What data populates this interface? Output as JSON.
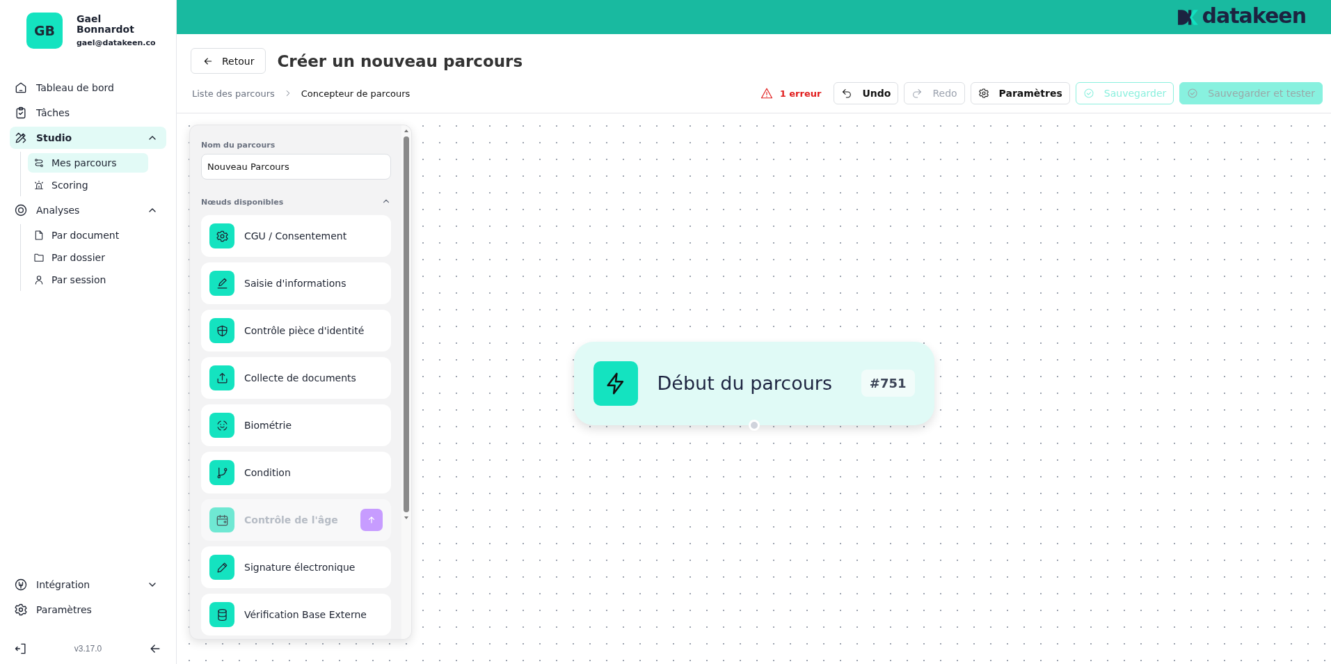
{
  "user": {
    "initials": "GB",
    "name": "Gael Bonnardot",
    "email": "gael@datakeen.co"
  },
  "nav": [
    {
      "label": "Tableau de bord",
      "selected": false
    },
    {
      "label": "Tâches",
      "selected": false
    },
    {
      "label": "Studio",
      "selected": true,
      "expanded": true,
      "children": [
        {
          "label": "Mes parcours",
          "selected": true
        },
        {
          "label": "Scoring",
          "selected": false
        }
      ]
    },
    {
      "label": "Analyses",
      "selected": false,
      "expanded": true,
      "children": [
        {
          "label": "Par document",
          "selected": false
        },
        {
          "label": "Par dossier",
          "selected": false
        },
        {
          "label": "Par session",
          "selected": false
        }
      ]
    }
  ],
  "bottom_nav": [
    {
      "label": "Intégration",
      "selected": false,
      "expanded": false
    },
    {
      "label": "Paramètres",
      "selected": false
    }
  ],
  "version": "v3.17.0",
  "logo": {
    "text": "datakeen"
  },
  "header": {
    "back_button": "Retour",
    "title": "Créer un nouveau parcours"
  },
  "breadcrumb": [
    "Liste des parcours",
    "Concepteur de parcours"
  ],
  "toolbar": {
    "error": "1 erreur",
    "buttons": [
      {
        "label": "Undo",
        "kind": "default",
        "disabled": false
      },
      {
        "label": "Redo",
        "kind": "default",
        "disabled": true
      },
      {
        "label": "Paramètres",
        "kind": "default",
        "disabled": false
      },
      {
        "label": "Sauvegarder",
        "kind": "outline",
        "disabled": true
      },
      {
        "label": "Sauvegarder et tester",
        "kind": "primary",
        "disabled": true
      }
    ]
  },
  "panel": {
    "name_label": "Nom du parcours",
    "name_value": "Nouveau Parcours",
    "section": "Nœuds disponibles",
    "section_expanded": true,
    "nodes": [
      {
        "label": "CGU / Consentement",
        "locked": false
      },
      {
        "label": "Saisie d'informations",
        "locked": false
      },
      {
        "label": "Contrôle pièce d'identité",
        "locked": false
      },
      {
        "label": "Collecte de documents",
        "locked": false
      },
      {
        "label": "Biométrie",
        "locked": false
      },
      {
        "label": "Condition",
        "locked": false
      },
      {
        "label": "Contrôle de l'âge",
        "locked": true
      },
      {
        "label": "Signature électronique",
        "locked": false
      },
      {
        "label": "Vérification Base Externe",
        "locked": false
      }
    ]
  },
  "start_node": {
    "title": "Début du parcours",
    "id": "#751"
  }
}
